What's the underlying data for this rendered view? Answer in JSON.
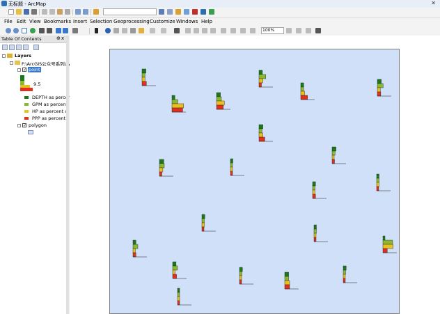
{
  "window": {
    "title": "无标题 - ArcMap",
    "close_glyph": "✕"
  },
  "menu": [
    "File",
    "Edit",
    "View",
    "Bookmarks",
    "Insert",
    "Selection",
    "Geoprocessing",
    "Customize",
    "Windows",
    "Help"
  ],
  "toolbar": {
    "scale_combo_value": "",
    "zoom_combo_value": "100%"
  },
  "toc": {
    "header": "Table Of Contents",
    "pin_glyph": "⊕",
    "close_glyph": "x",
    "layers_label": "Layers",
    "folder_label": "F:\\ArcGIS公众号系列\\W",
    "point_layer": "point",
    "legend_value": "9.5",
    "legend_items": [
      {
        "label": "DEPTH as percent",
        "color": "#1a7a1a"
      },
      {
        "label": "GPM as percent",
        "color": "#8ab830"
      },
      {
        "label": "HP as percent c",
        "color": "#e8c020"
      },
      {
        "label": "PPP as percent",
        "color": "#e03020"
      }
    ],
    "polygon_layer": "polygon"
  },
  "colors": {
    "depth": "#1a7a1a",
    "gpm": "#8ab830",
    "hp": "#e8c020",
    "ppp": "#e03020",
    "map_bg": "#cfe0f8"
  },
  "symbols": [
    {
      "depth": 0.8,
      "gpm": 0.6,
      "hp": 0.6,
      "ppp": 0.9
    },
    {
      "depth": 0.7,
      "gpm": 1.4,
      "hp": 0.8,
      "ppp": 0.5
    },
    {
      "depth": 0.6,
      "gpm": 1.2,
      "hp": 2.4,
      "ppp": 2.2
    },
    {
      "depth": 0.8,
      "gpm": 1.0,
      "hp": 1.6,
      "ppp": 1.4
    },
    {
      "depth": 0.6,
      "gpm": 0.6,
      "hp": 0.8,
      "ppp": 1.4
    },
    {
      "depth": 0.8,
      "gpm": 1.2,
      "hp": 0.6,
      "ppp": 0.7
    },
    {
      "depth": 0.8,
      "gpm": 0.6,
      "hp": 0.8,
      "ppp": 1.2
    },
    {
      "depth": 0.9,
      "gpm": 1.0,
      "hp": 0.7,
      "ppp": 0.5
    },
    {
      "depth": 0.5,
      "gpm": 0.4,
      "hp": 0.3,
      "ppp": 0.3
    },
    {
      "depth": 0.8,
      "gpm": 0.6,
      "hp": 0.4,
      "ppp": 0.5
    },
    {
      "depth": 0.7,
      "gpm": 1.0,
      "hp": 0.5,
      "ppp": 0.8
    },
    {
      "depth": 0.6,
      "gpm": 0.5,
      "hp": 0.5,
      "ppp": 0.4
    },
    {
      "depth": 0.6,
      "gpm": 0.5,
      "hp": 0.5,
      "ppp": 0.6
    },
    {
      "depth": 0.5,
      "gpm": 0.5,
      "hp": 0.5,
      "ppp": 0.3
    },
    {
      "depth": 0.5,
      "gpm": 0.5,
      "hp": 0.4,
      "ppp": 0.4
    },
    {
      "depth": 0.6,
      "gpm": 1.0,
      "hp": 0.5,
      "ppp": 0.6
    },
    {
      "depth": 0.4,
      "gpm": 2.0,
      "hp": 2.1,
      "ppp": 0.9
    },
    {
      "depth": 0.6,
      "gpm": 0.5,
      "hp": 0.3,
      "ppp": 0.3
    },
    {
      "depth": 0.8,
      "gpm": 0.8,
      "hp": 1.0,
      "ppp": 1.0
    },
    {
      "depth": 0.6,
      "gpm": 0.5,
      "hp": 0.4,
      "ppp": 0.3
    },
    {
      "depth": 0.4,
      "gpm": 0.4,
      "hp": 0.3,
      "ppp": 0.3
    }
  ]
}
